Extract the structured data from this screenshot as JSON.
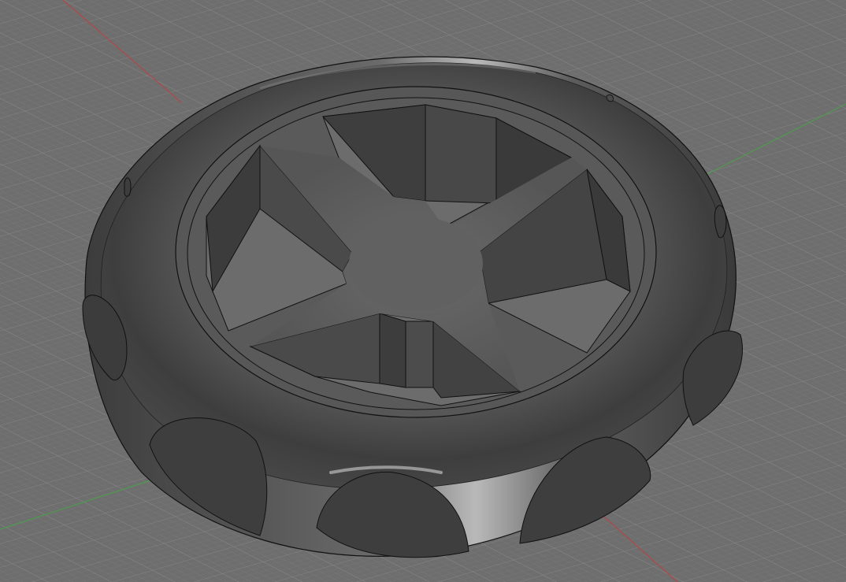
{
  "viewport": {
    "background": "#6e6e6e",
    "grid_minor": "#7a7a7a",
    "grid_major": "#888888",
    "axis_x_color": "#b04848",
    "axis_y_color": "#4f9a4f"
  },
  "model": {
    "body_color": "#555555",
    "edge_color": "#111111",
    "cutout_floor_color": "#6c6c6c",
    "scallop_count": 9,
    "spoke_count": 4
  }
}
